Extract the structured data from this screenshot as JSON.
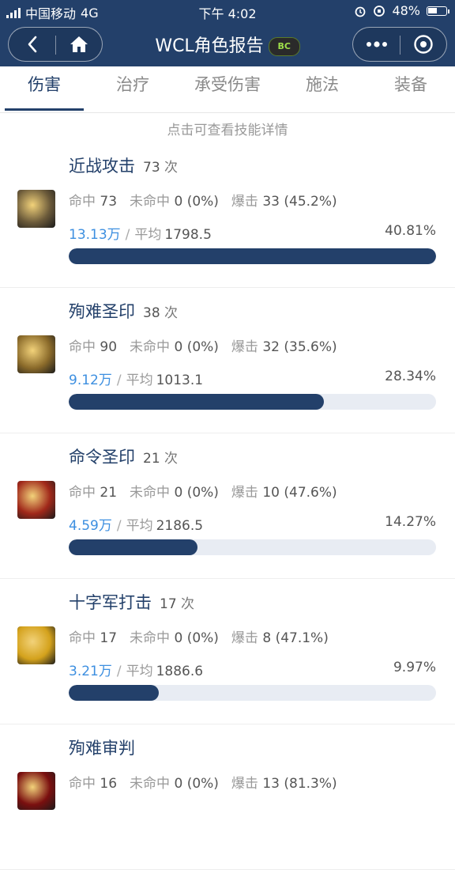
{
  "status": {
    "carrier": "中国移动",
    "network": "4G",
    "time": "下午 4:02",
    "battery": "48%"
  },
  "nav": {
    "title": "WCL角色报告",
    "badge": "BC"
  },
  "tabs": [
    "伤害",
    "治疗",
    "承受伤害",
    "施法",
    "装备"
  ],
  "hint": "点击可查看技能详情",
  "labels": {
    "hit": "命中",
    "miss": "未命中",
    "crit": "爆击",
    "avg": "平均",
    "times": "次",
    "slash": "/"
  },
  "skills": [
    {
      "name": "近战攻击",
      "count": "73",
      "hit": "73",
      "miss": "0",
      "miss_pct": "(0%)",
      "crit": "33",
      "crit_pct": "(45.2%)",
      "damage": "13.13万",
      "avg": "1798.5",
      "pct": "40.81%",
      "ratio": 1.0,
      "icon_color": "#6b5a3a"
    },
    {
      "name": "殉难圣印",
      "count": "38",
      "hit": "90",
      "miss": "0",
      "miss_pct": "(0%)",
      "crit": "32",
      "crit_pct": "(35.6%)",
      "damage": "9.12万",
      "avg": "1013.1",
      "pct": "28.34%",
      "ratio": 0.6944,
      "icon_color": "#8a6a2a"
    },
    {
      "name": "命令圣印",
      "count": "21",
      "hit": "21",
      "miss": "0",
      "miss_pct": "(0%)",
      "crit": "10",
      "crit_pct": "(47.6%)",
      "damage": "4.59万",
      "avg": "2186.5",
      "pct": "14.27%",
      "ratio": 0.3497,
      "icon_color": "#a0281a"
    },
    {
      "name": "十字军打击",
      "count": "17",
      "hit": "17",
      "miss": "0",
      "miss_pct": "(0%)",
      "crit": "8",
      "crit_pct": "(47.1%)",
      "damage": "3.21万",
      "avg": "1886.6",
      "pct": "9.97%",
      "ratio": 0.2443,
      "icon_color": "#d4a21c"
    },
    {
      "name": "殉难审判",
      "count": "",
      "hit": "16",
      "miss": "0",
      "miss_pct": "(0%)",
      "crit": "13",
      "crit_pct": "(81.3%)",
      "damage": "",
      "avg": "",
      "pct": "",
      "ratio": 0,
      "icon_color": "#7a0f0f"
    }
  ]
}
